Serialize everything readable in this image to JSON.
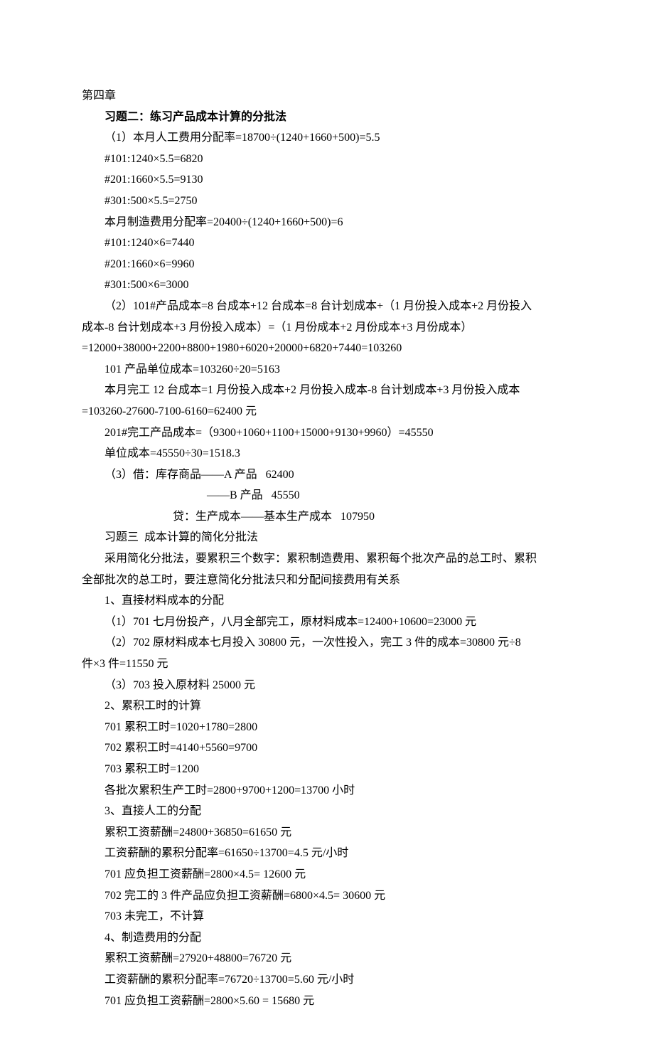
{
  "lines": [
    {
      "text": "第四章",
      "cls": "line"
    },
    {
      "text": "习题二：练习产品成本计算的分批法",
      "cls": "line indent-1 bold"
    },
    {
      "text": "（1）本月人工费用分配率=18700÷(1240+1660+500)=5.5",
      "cls": "line indent-1"
    },
    {
      "text": "#101:1240×5.5=6820",
      "cls": "line indent-1"
    },
    {
      "text": "#201:1660×5.5=9130",
      "cls": "line indent-1"
    },
    {
      "text": "#301:500×5.5=2750",
      "cls": "line indent-1"
    },
    {
      "text": "本月制造费用分配率=20400÷(1240+1660+500)=6",
      "cls": "line indent-1"
    },
    {
      "text": "#101:1240×6=7440",
      "cls": "line indent-1"
    },
    {
      "text": "#201:1660×6=9960",
      "cls": "line indent-1"
    },
    {
      "text": "#301:500×6=3000",
      "cls": "line indent-1"
    },
    {
      "text": "（2）101#产品成本=8 台成本+12 台成本=8 台计划成本+（1 月份投入成本+2 月份投入",
      "cls": "line indent-1"
    },
    {
      "text": "成本-8 台计划成本+3 月份投入成本）=（1 月份成本+2 月份成本+3 月份成本）",
      "cls": "line"
    },
    {
      "text": "=12000+38000+2200+8800+1980+6020+20000+6820+7440=103260",
      "cls": "line"
    },
    {
      "text": "101 产品单位成本=103260÷20=5163",
      "cls": "line indent-1"
    },
    {
      "text": "本月完工 12 台成本=1 月份投入成本+2 月份投入成本-8 台计划成本+3 月份投入成本",
      "cls": "line indent-1"
    },
    {
      "text": "=103260-27600-7100-6160=62400 元",
      "cls": "line"
    },
    {
      "text": "201#完工产品成本=（9300+1060+1100+15000+9130+9960）=45550",
      "cls": "line indent-1"
    },
    {
      "text": "单位成本=45550÷30=1518.3",
      "cls": "line indent-1"
    },
    {
      "text": "（3）借：库存商品——A 产品   62400",
      "cls": "line indent-1"
    },
    {
      "text": "——B 产品   45550",
      "cls": "line indent-center"
    },
    {
      "text": "贷：生产成本——基本生产成本   107950",
      "cls": "line indent-center2"
    },
    {
      "text": "习题三  成本计算的简化分批法",
      "cls": "line indent-1"
    },
    {
      "text": "采用简化分批法，要累积三个数字：累积制造费用、累积每个批次产品的总工时、累积",
      "cls": "line indent-1"
    },
    {
      "text": "全部批次的总工时，要注意简化分批法只和分配间接费用有关系",
      "cls": "line"
    },
    {
      "text": "1、直接材料成本的分配",
      "cls": "line indent-1"
    },
    {
      "text": "（1）701 七月份投产，八月全部完工，原材料成本=12400+10600=23000 元",
      "cls": "line indent-1"
    },
    {
      "text": "（2）702 原材料成本七月投入 30800 元，一次性投入，完工 3 件的成本=30800 元÷8",
      "cls": "line indent-1"
    },
    {
      "text": "件×3 件=11550 元",
      "cls": "line"
    },
    {
      "text": "（3）703 投入原材料 25000 元",
      "cls": "line indent-1"
    },
    {
      "text": "2、累积工时的计算",
      "cls": "line indent-1"
    },
    {
      "text": "701 累积工时=1020+1780=2800",
      "cls": "line indent-1"
    },
    {
      "text": "702 累积工时=4140+5560=9700",
      "cls": "line indent-1"
    },
    {
      "text": "703 累积工时=1200",
      "cls": "line indent-1"
    },
    {
      "text": "各批次累积生产工时=2800+9700+1200=13700 小时",
      "cls": "line indent-1"
    },
    {
      "text": "3、直接人工的分配",
      "cls": "line indent-1"
    },
    {
      "text": "累积工资薪酬=24800+36850=61650 元",
      "cls": "line indent-1"
    },
    {
      "text": "工资薪酬的累积分配率=61650÷13700=4.5 元/小时",
      "cls": "line indent-1"
    },
    {
      "text": "701 应负担工资薪酬=2800×4.5= 12600 元",
      "cls": "line indent-1"
    },
    {
      "text": "702 完工的 3 件产品应负担工资薪酬=6800×4.5= 30600 元",
      "cls": "line indent-1"
    },
    {
      "text": "703 未完工，不计算",
      "cls": "line indent-1"
    },
    {
      "text": "4、制造费用的分配",
      "cls": "line indent-1"
    },
    {
      "text": "累积工资薪酬=27920+48800=76720 元",
      "cls": "line indent-1"
    },
    {
      "text": "工资薪酬的累积分配率=76720÷13700=5.60 元/小时",
      "cls": "line indent-1"
    },
    {
      "text": "701 应负担工资薪酬=2800×5.60 = 15680 元",
      "cls": "line indent-1"
    }
  ]
}
